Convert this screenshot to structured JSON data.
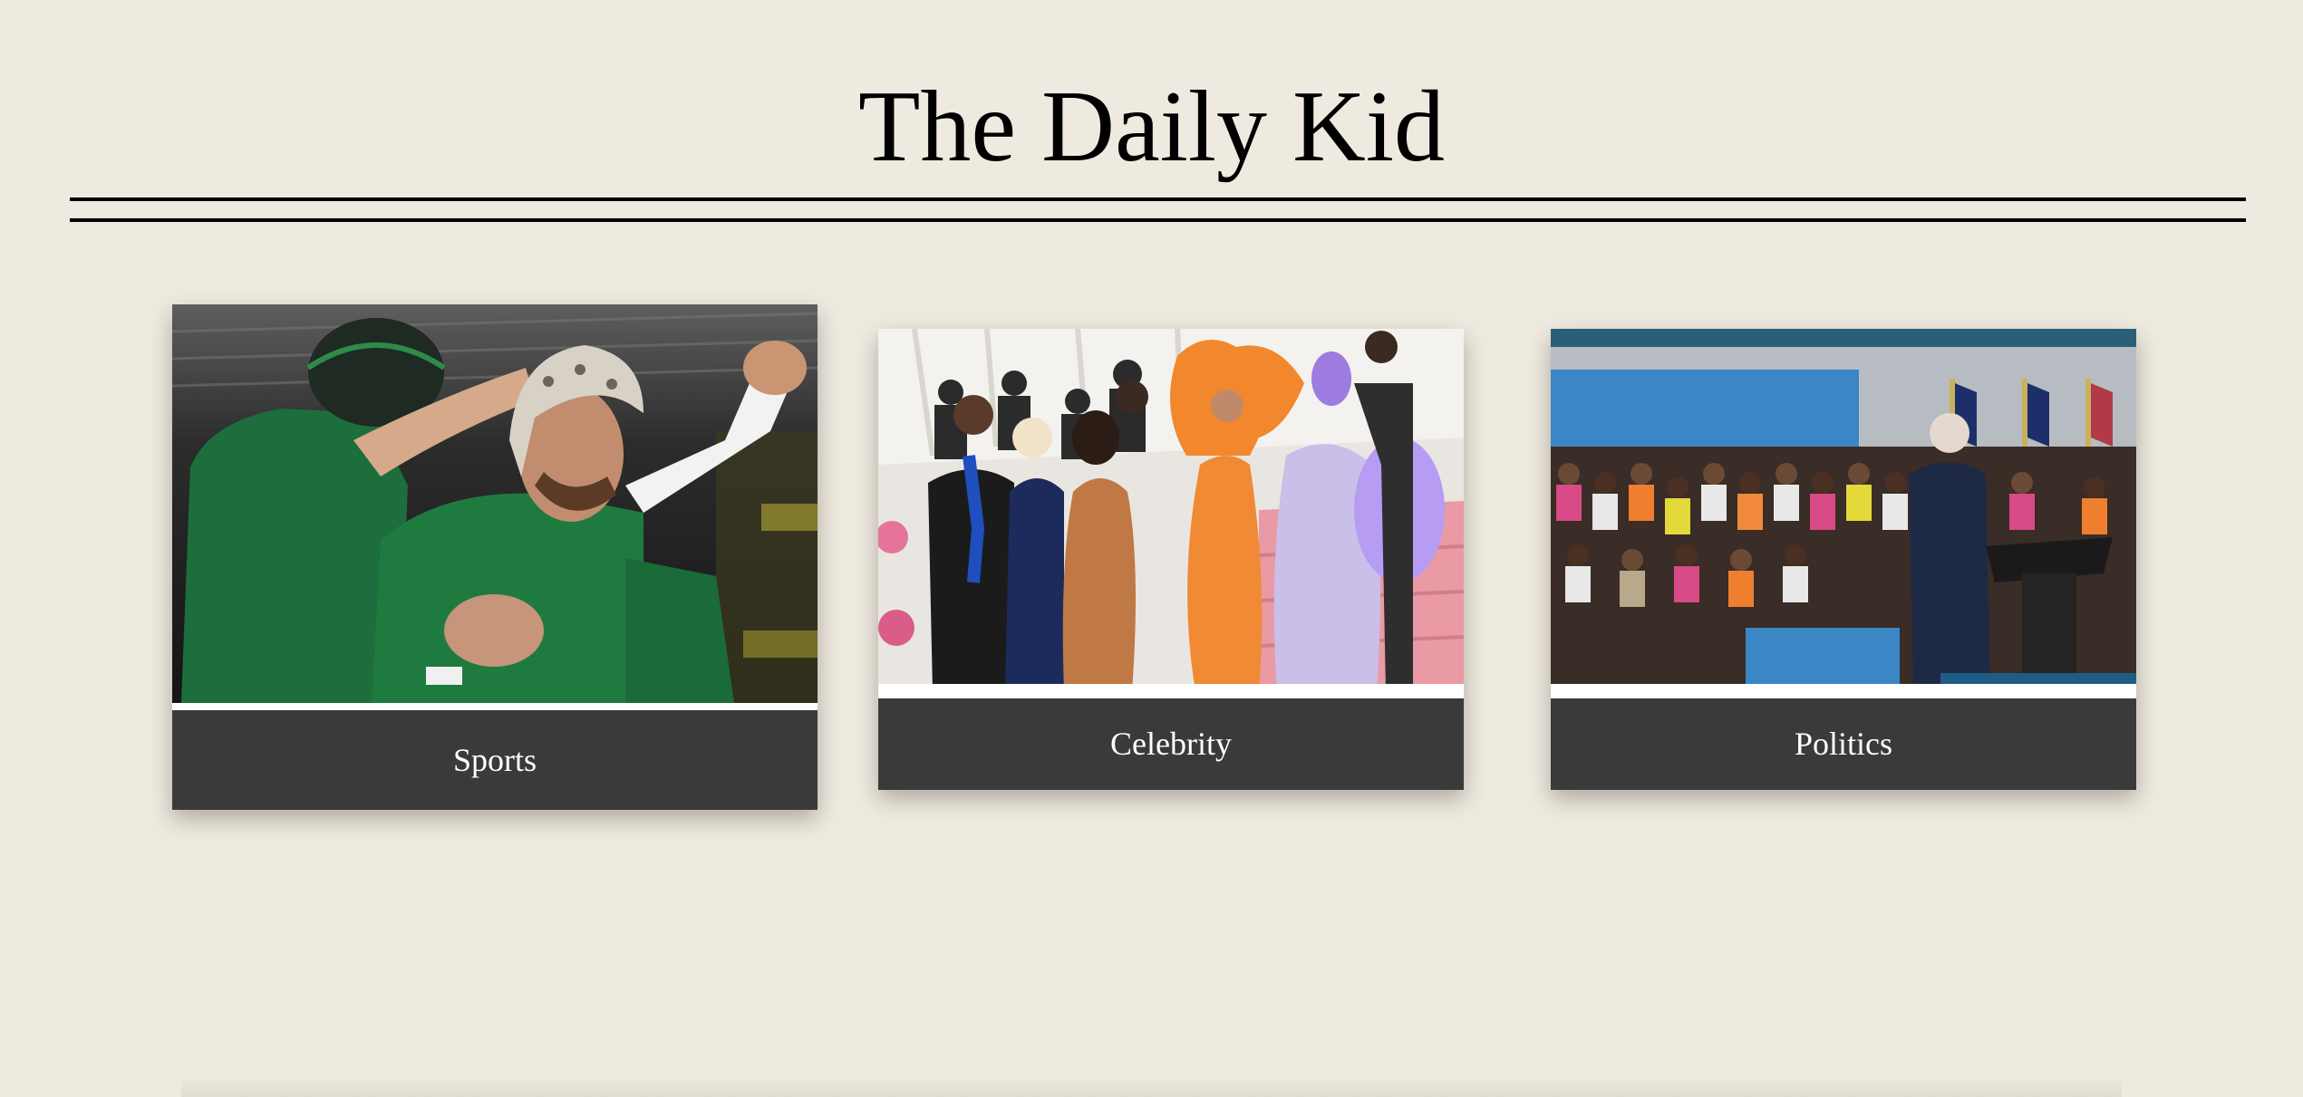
{
  "masthead": {
    "title": "The Daily Kid"
  },
  "cards": [
    {
      "label": "Sports",
      "image": "rugby-celebration-photo"
    },
    {
      "label": "Celebrity",
      "image": "red-carpet-photo"
    },
    {
      "label": "Politics",
      "image": "political-rally-photo"
    }
  ],
  "colors": {
    "background": "#efeadf",
    "card_label_bg": "#3a3a3a",
    "card_label_text": "#ffffff",
    "rule": "#000000"
  }
}
